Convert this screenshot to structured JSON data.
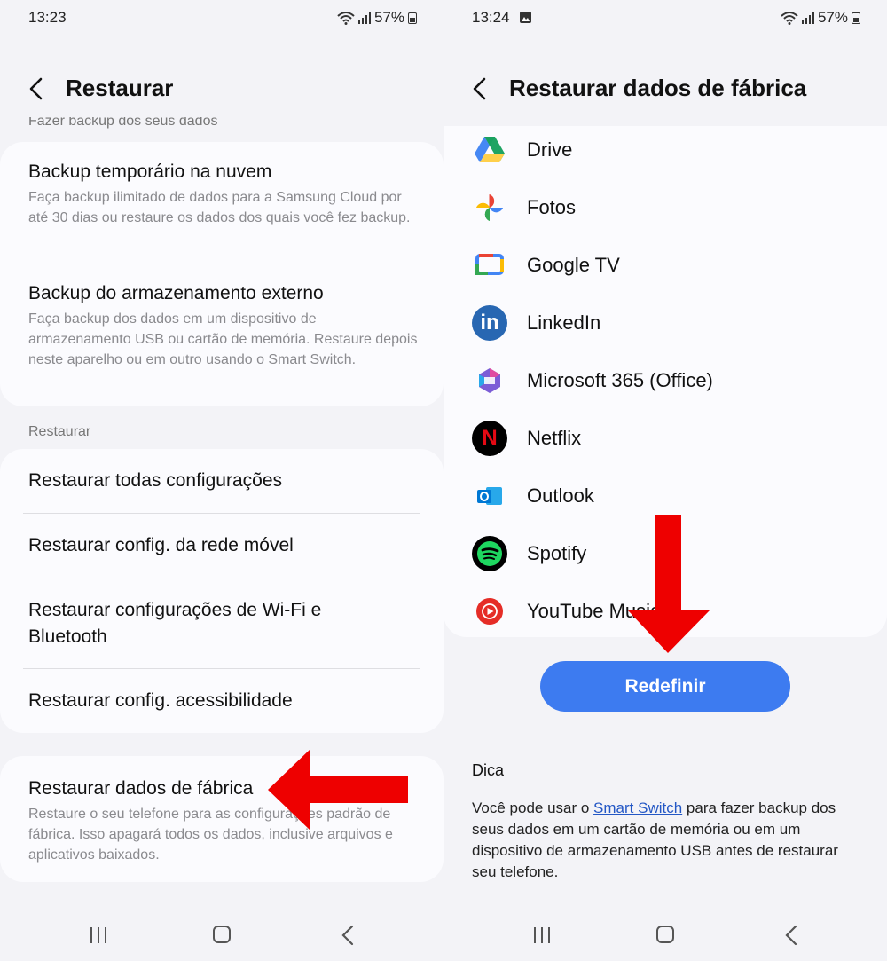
{
  "left": {
    "status": {
      "time": "13:23",
      "battery": "57%"
    },
    "title": "Restaurar",
    "partial_section_label": "Fazer backup dos seus dados",
    "backup_items": [
      {
        "title": "Backup temporário na nuvem",
        "desc": "Faça backup ilimitado de dados para a Samsung Cloud por até 30 dias ou restaure os dados dos quais você fez backup."
      },
      {
        "title": "Backup do armazenamento externo",
        "desc": "Faça backup dos dados em um dispositivo de armazenamento USB ou cartão de memória. Restaure depois neste aparelho ou em outro usando o Smart Switch."
      }
    ],
    "reset_section_label": "Restaurar",
    "reset_items": [
      {
        "title": "Restaurar todas configurações"
      },
      {
        "title": "Restaurar config. da rede móvel"
      },
      {
        "title": "Restaurar configurações de Wi-Fi e Bluetooth"
      },
      {
        "title": "Restaurar config. acessibilidade"
      }
    ],
    "factory_reset": {
      "title": "Restaurar dados de fábrica",
      "desc": "Restaure o seu telefone para as configurações padrão de fábrica. Isso apagará todos os dados, inclusive arquivos e aplicativos baixados."
    }
  },
  "right": {
    "status": {
      "time": "13:24",
      "battery": "57%"
    },
    "title": "Restaurar dados de fábrica",
    "apps": [
      {
        "name": "Drive",
        "icon": "google-drive-icon"
      },
      {
        "name": "Fotos",
        "icon": "google-photos-icon"
      },
      {
        "name": "Google TV",
        "icon": "google-tv-icon"
      },
      {
        "name": "LinkedIn",
        "icon": "linkedin-icon"
      },
      {
        "name": "Microsoft 365 (Office)",
        "icon": "microsoft-365-icon"
      },
      {
        "name": "Netflix",
        "icon": "netflix-icon"
      },
      {
        "name": "Outlook",
        "icon": "outlook-icon"
      },
      {
        "name": "Spotify",
        "icon": "spotify-icon"
      },
      {
        "name": "YouTube Music",
        "icon": "youtube-music-icon"
      }
    ],
    "reset_button": "Redefinir",
    "tip_title": "Dica",
    "tip_before": "Você pode usar o ",
    "tip_link": "Smart Switch",
    "tip_after": " para fazer backup dos seus dados em um cartão de memória ou em um dispositivo de armazenamento USB antes de restaurar seu telefone."
  },
  "colors": {
    "accent": "#3d7bf0",
    "annotation_arrow": "#ee0000",
    "background": "#f3f3f7",
    "card": "#fbfbfe"
  }
}
